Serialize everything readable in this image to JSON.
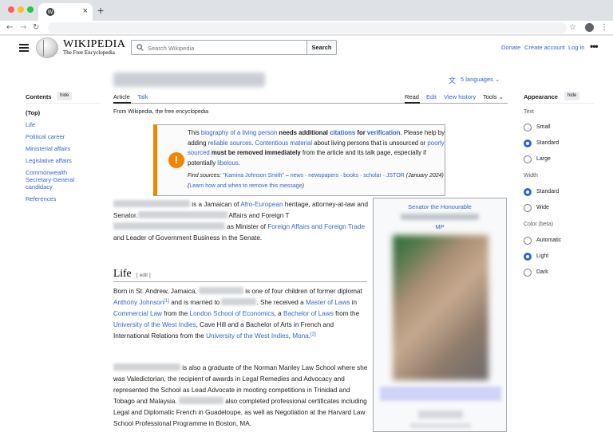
{
  "browser": {
    "tab_close_glyph": "×",
    "new_tab_glyph": "+"
  },
  "header": {
    "logo_title": "WIKIPEDIA",
    "logo_tagline": "The Free Encyclopedia",
    "search_placeholder": "Search Wikipedia",
    "search_button": "Search",
    "links": [
      "Donate",
      "Create account",
      "Log in"
    ]
  },
  "toc": {
    "heading": "Contents",
    "hide_label": "hide",
    "items": [
      "(Top)",
      "Life",
      "Political career",
      "Ministerial affairs",
      "Legislative affairs",
      "Commonwealth Secretary-General candidacy",
      "References"
    ]
  },
  "article": {
    "languages": "5 languages",
    "tabs_left": [
      "Article",
      "Talk"
    ],
    "tabs_right": [
      "Read",
      "Edit",
      "View history",
      "Tools"
    ],
    "from_wikipedia": "From Wikipedia, the free encyclopedia"
  },
  "ambox": {
    "icon": "!",
    "p1": "This ",
    "link_bio": "biography of a living person",
    "p2": " needs additional ",
    "link_citations": "citations",
    "p3": " for ",
    "link_verification": "verification",
    "p4": ". Please help by adding ",
    "link_reliable": "reliable sources",
    "p5": ". ",
    "link_contentious": "Contentious material",
    "p6": " about living persons that is unsourced or ",
    "link_poorly": "poorly sourced",
    "p7": " must be removed immediately",
    "p8": " from the article and its talk page, especially if potentially ",
    "link_libelous": "libelous",
    "p9": ".",
    "find_label": "Find sources: ",
    "find_query": "\"Kamina Johnson Smith\"",
    "find_links": [
      "news",
      "newspapers",
      "books",
      "scholar",
      "JSTOR"
    ],
    "find_date": "(January 2024)",
    "learn_open": "(",
    "learn_link": "Learn how and when to remove this message",
    "learn_close": ")"
  },
  "intro": {
    "t1": " is a Jamaican of ",
    "link_afro": "Afro-European",
    "t2": " heritage, attorney-at-law and Senator.",
    "t3": " Affairs and Foreign T",
    "t4": " as Minister of ",
    "link_ministry": "Foreign Affairs and Foreign Trade",
    "t5": " and Leader of Government Business in the Senate."
  },
  "life": {
    "heading": "Life",
    "edit": "[ edit ]",
    "p1_a": "Born in St. Andrew, Jamaica, ",
    "p1_b": " is one of four children of former diplomat ",
    "link_anthony": "Anthony Johnson",
    "ref1": "[1]",
    "p1_c": " and is married to ",
    "p1_d": ". She received a ",
    "link_master": "Master of Laws",
    "p1_e": " in ",
    "link_commercial": "Commercial Law",
    "p1_f": " from the ",
    "link_lse": "London School of Economics",
    "p1_g": ", a ",
    "link_bachelor": "Bachelor of Laws",
    "p1_h": " from the ",
    "link_uwi": "University of the West Indies",
    "p1_i": ", Cave Hill and a Bachelor of Arts in French and International Relations from the ",
    "link_uwi2": "University of the West Indies",
    "p1_j": ", ",
    "link_mona": "Mona",
    "ref2": "[2]",
    "p2_a": " is also a graduate of the Norman Manley Law School where she was Valedictorian, the recipient of awards in Legal Remedies and Advocacy and represented the School as Lead Advocate in mooting competitions in Trinidad and Tobago and Malaysia. ",
    "p2_b": " also completed professional certificates including Legal and Diplomatic French in Guadeloupe, as well as Negotiation at the Harvard Law School Professional Programme in Boston, MA."
  },
  "infobox": {
    "above": "Senator the Honourable",
    "mp": "MP"
  },
  "appearance": {
    "heading": "Appearance",
    "hide_label": "hide",
    "text_label": "Text",
    "text_options": [
      "Small",
      "Standard",
      "Large"
    ],
    "text_selected": "Standard",
    "width_label": "Width",
    "width_options": [
      "Standard",
      "Wide"
    ],
    "width_selected": "Standard",
    "color_label": "Color (beta)",
    "color_options": [
      "Automatic",
      "Light",
      "Dark"
    ],
    "color_selected": "Light"
  }
}
